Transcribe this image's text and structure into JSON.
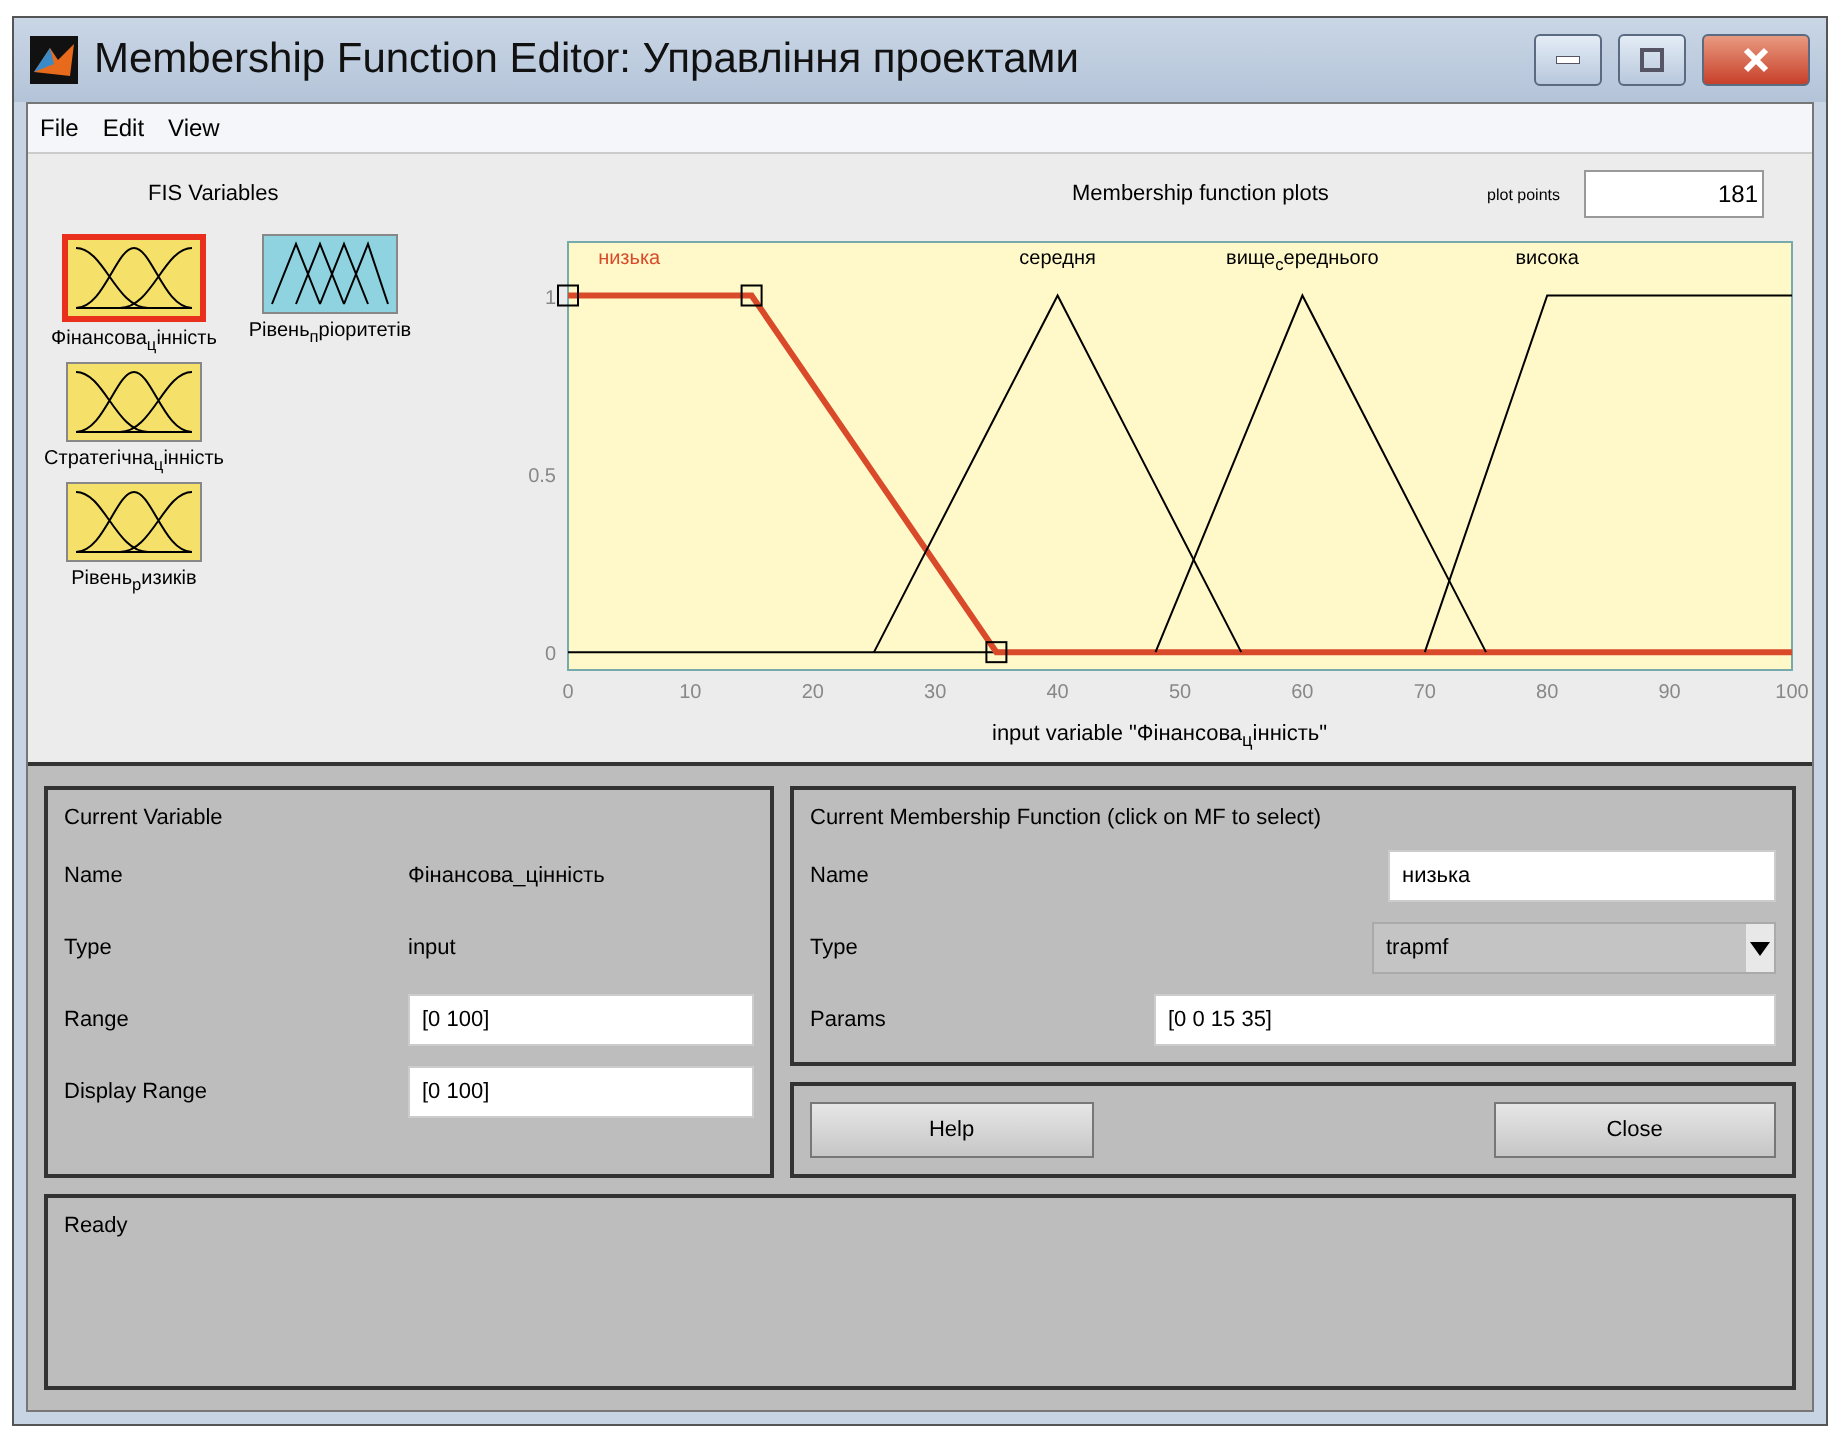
{
  "window": {
    "title": "Membership Function Editor: Управління проектами"
  },
  "menu": [
    "File",
    "Edit",
    "View"
  ],
  "fis_variables": {
    "title": "FIS Variables",
    "items": [
      {
        "label": "Фінансова$_{ц}$інність",
        "kind": "input",
        "selected": true
      },
      {
        "label": "Рівень$_{п}$ріоритетів",
        "kind": "output",
        "selected": false
      },
      {
        "label": "Стратегічна$_{ц}$інність",
        "kind": "input",
        "selected": false
      },
      {
        "label": "Рівень$_{р}$изиків",
        "kind": "input",
        "selected": false
      }
    ]
  },
  "plot": {
    "title": "Membership function plots",
    "plot_points_label": "plot points",
    "plot_points": "181",
    "mfs": [
      {
        "selected": true
      },
      {
        "selected": false
      },
      {
        "selected": false
      },
      {
        "selected": false
      }
    ],
    "chart_data": {
      "type": "line",
      "xlabel": "input variable \"Фінансова$_{ц}$інність\"",
      "x": [
        0,
        15,
        25,
        35,
        40,
        48,
        55,
        60,
        70,
        75,
        80,
        100
      ],
      "series": [
        {
          "name": "низька",
          "color": "#d94a2a",
          "values": [
            1,
            1,
            0.5,
            0,
            0,
            0,
            0,
            0,
            0,
            0,
            0,
            0
          ]
        },
        {
          "name": "середня",
          "color": "#000000",
          "values": [
            null,
            null,
            0,
            0.667,
            1,
            0.467,
            0,
            null,
            null,
            null,
            null,
            null
          ]
        },
        {
          "name": "вище$_{с}$ереднього",
          "color": "#000000",
          "values": [
            null,
            null,
            null,
            null,
            null,
            0,
            0.583,
            1,
            0.333,
            0,
            null,
            null
          ]
        },
        {
          "name": "висока",
          "color": "#000000",
          "values": [
            null,
            null,
            null,
            null,
            null,
            null,
            null,
            null,
            0,
            0.5,
            1,
            1
          ]
        }
      ],
      "xlim": [
        0,
        100
      ],
      "ylim": [
        -0.05,
        1.15
      ],
      "xticks": [
        0,
        10,
        20,
        30,
        40,
        50,
        60,
        70,
        80,
        90,
        100
      ],
      "yticks": [
        0,
        0.5,
        1
      ]
    }
  },
  "current_variable": {
    "title": "Current Variable",
    "rows": [
      {
        "label": "Name",
        "value": "Фінансова_цінність",
        "kind": "text"
      },
      {
        "label": "Type",
        "value": "input",
        "kind": "text"
      },
      {
        "label": "Range",
        "value": "[0 100]",
        "kind": "field"
      },
      {
        "label": "Display Range",
        "value": "[0 100]",
        "kind": "field"
      }
    ]
  },
  "current_mf": {
    "title": "Current Membership Function (click on MF to select)",
    "name_label": "Name",
    "name": "низька",
    "type_label": "Type",
    "type": "trapmf",
    "params_label": "Params",
    "params": "[0 0 15 35]"
  },
  "buttons": [
    "Help",
    "Close"
  ],
  "status": "Ready"
}
